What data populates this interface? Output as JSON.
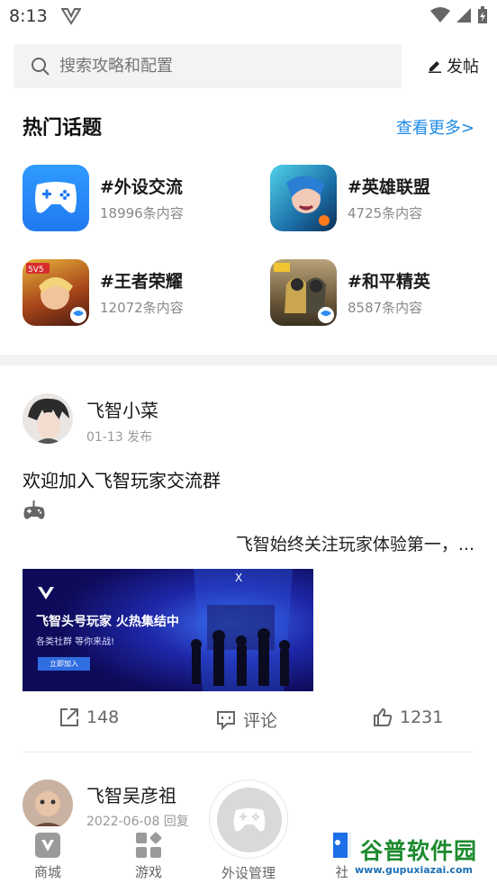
{
  "status_bar": {
    "time": "8:13"
  },
  "search": {
    "placeholder": "搜索攻略和配置",
    "post_label": "发帖"
  },
  "hot_topics": {
    "title": "热门话题",
    "see_more": "查看更多>",
    "items": [
      {
        "name": "#外设交流",
        "count": "18996条内容",
        "icon": "gamepad-icon"
      },
      {
        "name": "#英雄联盟",
        "count": "4725条内容",
        "icon": "league-of-legends-icon"
      },
      {
        "name": "#王者荣耀",
        "count": "12072条内容",
        "icon": "honor-of-kings-icon"
      },
      {
        "name": "#和平精英",
        "count": "8587条内容",
        "icon": "peace-elite-icon"
      }
    ]
  },
  "post": {
    "author": "飞智小菜",
    "meta": "01-13 发布",
    "title": "欢迎加入飞智玩家交流群",
    "emoji": "🎮",
    "body": "飞智始终关注玩家体验第一，...",
    "banner": {
      "headline": "飞智头号玩家 火热集结中",
      "sub": "各类社群 等你来战!",
      "button": "立即加入"
    },
    "actions": {
      "share_count": "148",
      "comment_label": "评论",
      "like_count": "1231"
    }
  },
  "next_post": {
    "author": "飞智吴彦祖",
    "meta": "2022-06-08 回复"
  },
  "bottom_nav": {
    "items": [
      "商城",
      "游戏",
      "外设管理",
      "社"
    ]
  },
  "watermark": {
    "title": "谷普软件园",
    "url": "www.gupuxiazai.com"
  },
  "colors": {
    "accent": "#1d8ae8",
    "divider": "#f2f2f2",
    "watermark_green": "#1c8a2e"
  }
}
